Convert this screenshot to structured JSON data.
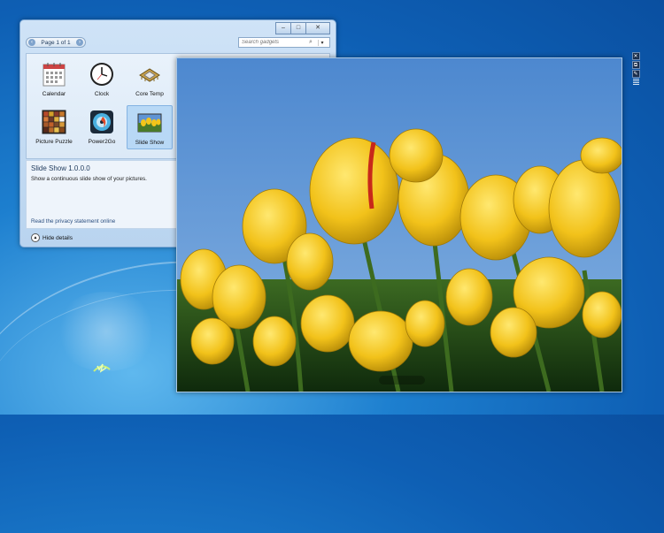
{
  "gallery": {
    "caption_buttons": {
      "minimize": "–",
      "restore": "□",
      "close": "✕"
    },
    "pager": {
      "label": "Page 1 of 1",
      "prev_icon": "‹",
      "next_icon": "›"
    },
    "search": {
      "placeholder": "Search gadgets",
      "icon": "search-icon",
      "dropdown": "▾"
    },
    "gadgets": [
      {
        "label": "Calendar",
        "icon": "calendar-icon"
      },
      {
        "label": "Clock",
        "icon": "clock-icon"
      },
      {
        "label": "Core Temp",
        "icon": "chip-icon"
      },
      {
        "label": "Picture Puzzle",
        "icon": "puzzle-icon"
      },
      {
        "label": "Power2Go",
        "icon": "disc-icon"
      },
      {
        "label": "Slide Show",
        "icon": "slideshow-icon",
        "selected": true
      }
    ],
    "details": {
      "title": "Slide Show 1.0.0.0",
      "description": "Show a continuous slide show of your pictures.",
      "privacy_link": "Read the privacy statement online"
    },
    "hide_details": {
      "label": "Hide details",
      "icon": "chevron-up-icon"
    }
  },
  "slideshow_gadget": {
    "image": "yellow tulips against blue sky",
    "tools": {
      "close": "✕",
      "size": "⧉",
      "options": "🔧"
    }
  },
  "colors": {
    "accent": "#1d7fcf",
    "window_glass": "#b9d4ef",
    "tulip": "#f3c51a",
    "sky": "#5f94d4"
  }
}
